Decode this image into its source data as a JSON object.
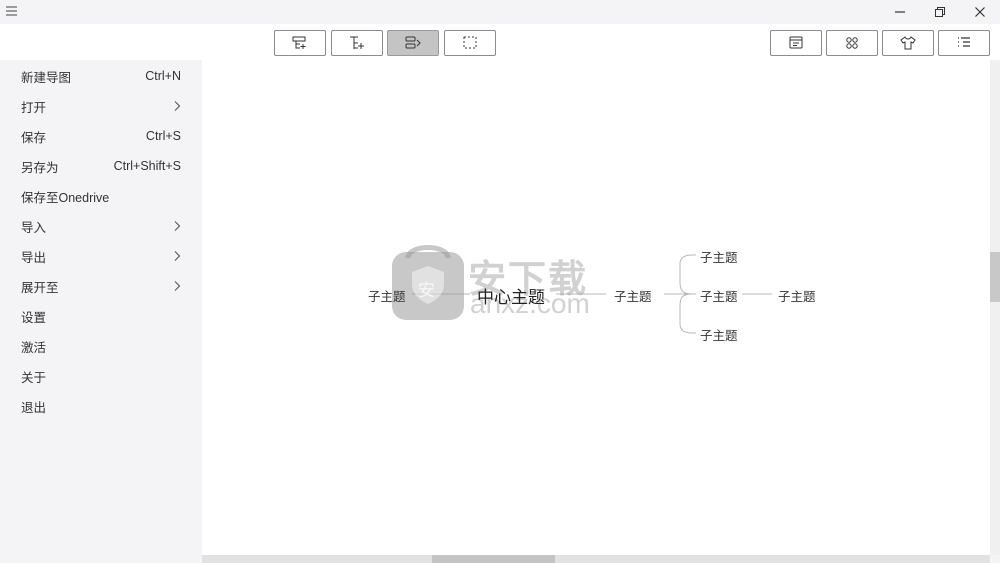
{
  "menu": {
    "items": [
      {
        "label": "新建导图",
        "shortcut": "Ctrl+N"
      },
      {
        "label": "打开",
        "shortcut": ""
      },
      {
        "label": "保存",
        "shortcut": "Ctrl+S"
      },
      {
        "label": "另存为",
        "shortcut": "Ctrl+Shift+S"
      },
      {
        "label": "保存至Onedrive",
        "shortcut": ""
      },
      {
        "label": "导入",
        "shortcut": ""
      },
      {
        "label": "导出",
        "shortcut": ""
      },
      {
        "label": "展开至",
        "shortcut": ""
      },
      {
        "label": "设置",
        "shortcut": ""
      },
      {
        "label": "激活",
        "shortcut": ""
      },
      {
        "label": "关于",
        "shortcut": ""
      },
      {
        "label": "退出",
        "shortcut": ""
      }
    ]
  },
  "mindmap": {
    "center": "中心主题",
    "left_topic": "子主题",
    "right_topic": "子主题",
    "sub_topics": [
      "子主题",
      "子主题",
      "子主题"
    ],
    "sub_sub_topic": "子主题"
  },
  "watermark": {
    "text": "安下载",
    "domain": "anxz.com",
    "badge": "安"
  },
  "toolbar": {
    "active_tool": "layout"
  },
  "colors": {
    "accent": "#c4c4c4",
    "line": "#b0b0b0",
    "background": "#f4f4f6"
  }
}
